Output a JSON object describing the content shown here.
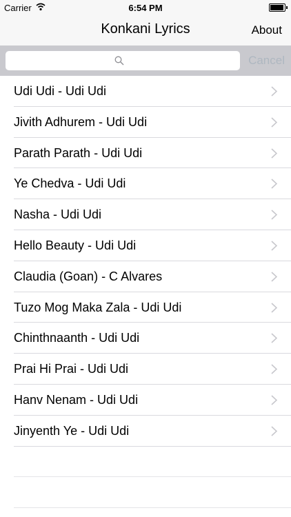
{
  "status_bar": {
    "carrier": "Carrier",
    "time": "6:54 PM"
  },
  "nav": {
    "title": "Konkani Lyrics",
    "about_label": "About"
  },
  "search": {
    "placeholder": "",
    "value": "",
    "cancel_label": "Cancel"
  },
  "songs": [
    "Udi Udi - Udi Udi",
    "Jivith Adhurem - Udi Udi",
    "Parath Parath - Udi Udi",
    "Ye Chedva - Udi Udi",
    "Nasha - Udi Udi",
    "Hello Beauty - Udi Udi",
    "Claudia (Goan) - C Alvares",
    "Tuzo Mog Maka Zala - Udi Udi",
    "Chinthnaanth - Udi Udi",
    "Prai Hi Prai - Udi Udi",
    "Hanv Nenam - Udi Udi",
    "Jinyenth Ye - Udi Udi"
  ],
  "colors": {
    "accent_disabled": "#aeb7c0",
    "search_bg": "#c9c9ce",
    "bar_bg": "#f7f7f7"
  }
}
